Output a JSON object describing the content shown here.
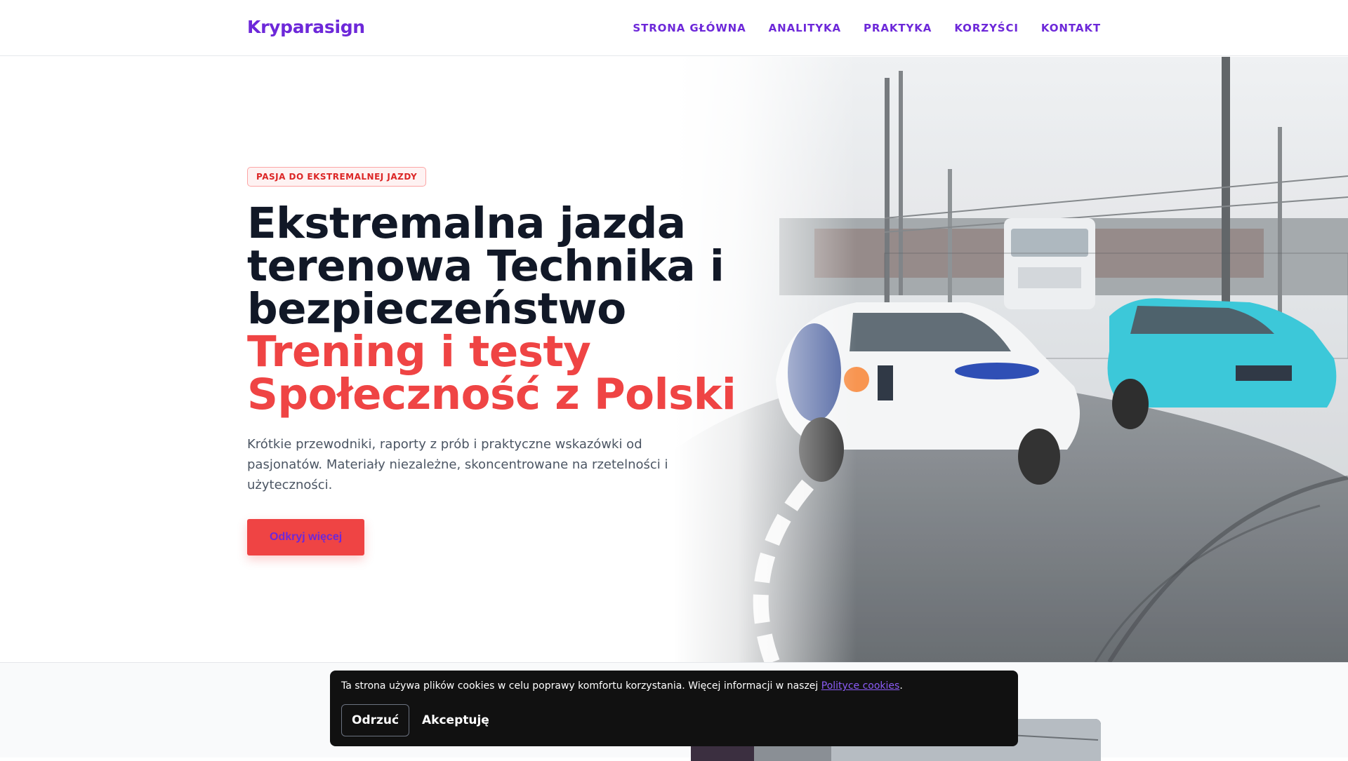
{
  "brand": "Kryparasign",
  "nav": [
    {
      "label": "STRONA GŁÓWNA"
    },
    {
      "label": "ANALITYKA"
    },
    {
      "label": "PRAKTYKA"
    },
    {
      "label": "KORZYŚCI"
    },
    {
      "label": "KONTAKT"
    }
  ],
  "hero": {
    "tagline": "PASJA DO EKSTREMALNEJ JAZDY",
    "headline_lines": [
      "Ekstremalna jazda",
      "terenowa Technika i",
      "bezpieczeństwo"
    ],
    "headline_accent_lines": [
      "Trening i testy",
      "Społeczność z Polski"
    ],
    "lead": "Krótkie przewodniki, raporty z prób i praktyczne wskazówki od pasjonatów. Materiały niezależne, skoncentrowane na rzetelności i użyteczności.",
    "cta": "Odkryj więcej",
    "photo_icon": "rally-cars-photo"
  },
  "cookie": {
    "text": "Ta strona używa plików cookies w celu poprawy komfortu korzystania. Więcej informacji w naszej ",
    "link": "Polityce cookies",
    "text_end": ".",
    "reject": "Odrzuć",
    "accept": "Akceptuję"
  },
  "colors": {
    "brand": "#6d28d9",
    "accent": "#ef4444",
    "heading": "#111827"
  }
}
